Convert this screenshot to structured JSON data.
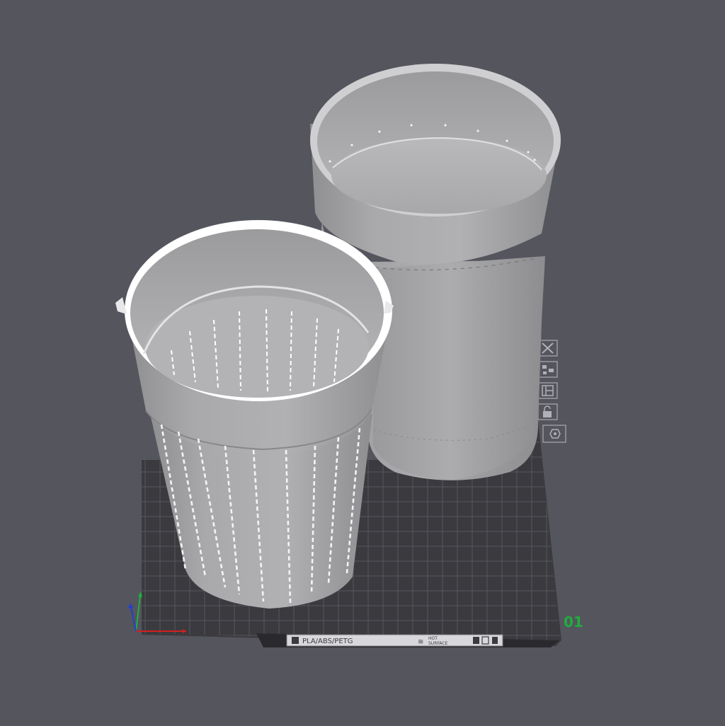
{
  "viewport": {
    "plate_number": "01",
    "plate_label": {
      "material": "PLA/ABS/PETG",
      "hot_line1": "HOT",
      "hot_line2": "SURFACE"
    }
  },
  "plate_toolbar": [
    {
      "name": "delete-plate-button",
      "icon": "close-icon"
    },
    {
      "name": "arrange-plate-button",
      "icon": "arrange-icon"
    },
    {
      "name": "orient-plate-button",
      "icon": "layout-icon"
    },
    {
      "name": "lock-plate-button",
      "icon": "lock-icon"
    },
    {
      "name": "plate-settings-button",
      "icon": "gear-icon"
    }
  ],
  "objects": [
    {
      "name": "strainer-basket-model",
      "type": "perforated-cup"
    },
    {
      "name": "outer-cup-model",
      "type": "solid-cup"
    }
  ],
  "colors": {
    "background": "#55555e",
    "plate": "#3b3b40",
    "grid": "#55555c",
    "model": "#a9a9ab",
    "plate_number": "#1fae3c",
    "axis_x": "#d02020",
    "axis_y": "#20b040",
    "axis_z": "#2040d0"
  }
}
